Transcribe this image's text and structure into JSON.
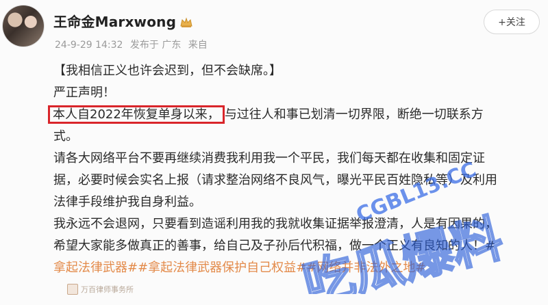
{
  "post": {
    "author": "王命金Marxwong",
    "verified_icon": "crown-icon",
    "time": "24-9-29 14:32",
    "published_from": "发布于 广东",
    "source": "来自",
    "follow_label": "+关注",
    "lines": [
      "【我相信正义也许会迟到，但不会缺席。】",
      "严正声明！",
      "本人自2022年恢复单身以来，",
      "与过往人和事已划清一切界限，断绝一切联系方",
      "式。",
      "请各大网络平台不要再继续消费我利用我一个平民，我们每天都在收集和固定证",
      "据，必要时候会实名上报（请求整治网络不良风气，曝光平民百姓隐私等）及利用",
      "法律手段维护我自身利益。",
      "我永远不会退网，只要看到造谣利用我的我就收集证据举报澄清，人是有因果的，",
      "希望大家能多做真正的善事，给自己及子孙后代积福，做一个正义有良知的人！#",
      "拿起法律武器##拿起法律武器保护自己权益##网络并非法外之地#"
    ],
    "attachment_caption": "万百律师事务所"
  },
  "watermark": {
    "text_top": "CGBL13.CC",
    "text_main": "吃瓜爆料"
  },
  "colors": {
    "highlight_border": "#d9252a",
    "tag_text": "#e38a49",
    "watermark": "#2b5fd9"
  }
}
